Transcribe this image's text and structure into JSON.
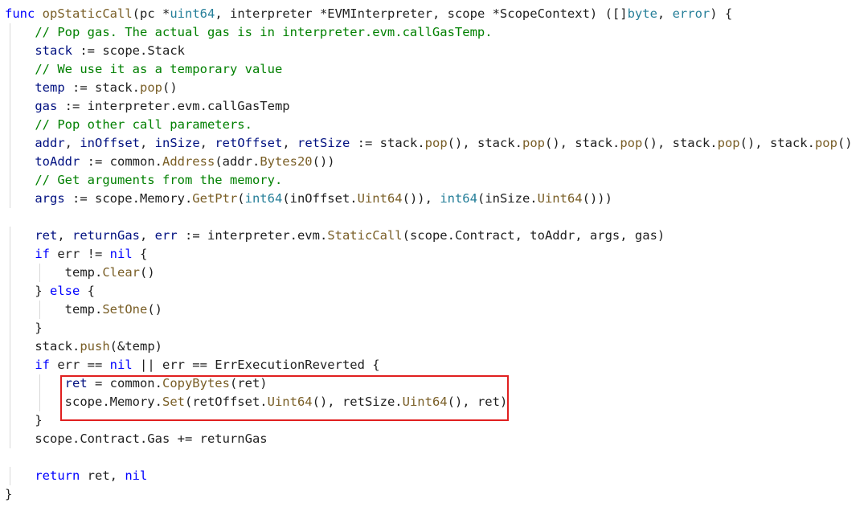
{
  "editor": {
    "theme": "light",
    "highlight_color": "#e02020"
  },
  "code_lines": [
    [
      [
        "kw",
        "func "
      ],
      [
        "fn",
        "opStaticCall"
      ],
      [
        "pl",
        "(pc "
      ],
      [
        "pl",
        "*"
      ],
      [
        "ty",
        "uint64"
      ],
      [
        "pl",
        ", interpreter *EVMInterpreter, scope *ScopeContext) ([]"
      ],
      [
        "ty",
        "byte"
      ],
      [
        "pl",
        ", "
      ],
      [
        "ty",
        "error"
      ],
      [
        "pl",
        ") {"
      ]
    ],
    [
      [
        "cm",
        "// Pop gas. The actual gas is in interpreter.evm.callGasTemp."
      ]
    ],
    [
      [
        "var",
        "stack"
      ],
      [
        "pl",
        " := scope.Stack"
      ]
    ],
    [
      [
        "cm",
        "// We use it as a temporary value"
      ]
    ],
    [
      [
        "var",
        "temp"
      ],
      [
        "pl",
        " := stack."
      ],
      [
        "fn",
        "pop"
      ],
      [
        "pl",
        "()"
      ]
    ],
    [
      [
        "var",
        "gas"
      ],
      [
        "pl",
        " := interpreter.evm.callGasTemp"
      ]
    ],
    [
      [
        "cm",
        "// Pop other call parameters."
      ]
    ],
    [
      [
        "var",
        "addr"
      ],
      [
        "pl",
        ", "
      ],
      [
        "var",
        "inOffset"
      ],
      [
        "pl",
        ", "
      ],
      [
        "var",
        "inSize"
      ],
      [
        "pl",
        ", "
      ],
      [
        "var",
        "retOffset"
      ],
      [
        "pl",
        ", "
      ],
      [
        "var",
        "retSize"
      ],
      [
        "pl",
        " := stack."
      ],
      [
        "fn",
        "pop"
      ],
      [
        "pl",
        "(), stack."
      ],
      [
        "fn",
        "pop"
      ],
      [
        "pl",
        "(), stack."
      ],
      [
        "fn",
        "pop"
      ],
      [
        "pl",
        "(), stack."
      ],
      [
        "fn",
        "pop"
      ],
      [
        "pl",
        "(), stack."
      ],
      [
        "fn",
        "pop"
      ],
      [
        "pl",
        "()"
      ]
    ],
    [
      [
        "var",
        "toAddr"
      ],
      [
        "pl",
        " := common."
      ],
      [
        "fn",
        "Address"
      ],
      [
        "pl",
        "(addr."
      ],
      [
        "fn",
        "Bytes20"
      ],
      [
        "pl",
        "())"
      ]
    ],
    [
      [
        "cm",
        "// Get arguments from the memory."
      ]
    ],
    [
      [
        "var",
        "args"
      ],
      [
        "pl",
        " := scope.Memory."
      ],
      [
        "fn",
        "GetPtr"
      ],
      [
        "pl",
        "("
      ],
      [
        "ty",
        "int64"
      ],
      [
        "pl",
        "(inOffset."
      ],
      [
        "fn",
        "Uint64"
      ],
      [
        "pl",
        "()), "
      ],
      [
        "ty",
        "int64"
      ],
      [
        "pl",
        "(inSize."
      ],
      [
        "fn",
        "Uint64"
      ],
      [
        "pl",
        "()))"
      ]
    ],
    [],
    [
      [
        "var",
        "ret"
      ],
      [
        "pl",
        ", "
      ],
      [
        "var",
        "returnGas"
      ],
      [
        "pl",
        ", "
      ],
      [
        "var",
        "err"
      ],
      [
        "pl",
        " := interpreter.evm."
      ],
      [
        "fn",
        "StaticCall"
      ],
      [
        "pl",
        "(scope.Contract, toAddr, args, gas)"
      ]
    ],
    [
      [
        "kw",
        "if "
      ],
      [
        "pl",
        "err != "
      ],
      [
        "kw",
        "nil"
      ],
      [
        "pl",
        " {"
      ]
    ],
    [
      [
        "pl",
        "temp."
      ],
      [
        "fn",
        "Clear"
      ],
      [
        "pl",
        "()"
      ]
    ],
    [
      [
        "pl",
        "} "
      ],
      [
        "kw",
        "else"
      ],
      [
        "pl",
        " {"
      ]
    ],
    [
      [
        "pl",
        "temp."
      ],
      [
        "fn",
        "SetOne"
      ],
      [
        "pl",
        "()"
      ]
    ],
    [
      [
        "pl",
        "}"
      ]
    ],
    [
      [
        "pl",
        "stack."
      ],
      [
        "fn",
        "push"
      ],
      [
        "pl",
        "(&temp)"
      ]
    ],
    [
      [
        "kw",
        "if "
      ],
      [
        "pl",
        "err == "
      ],
      [
        "kw",
        "nil"
      ],
      [
        "pl",
        " || err == ErrExecutionReverted {"
      ]
    ],
    [
      [
        "var",
        "ret"
      ],
      [
        "pl",
        " = common."
      ],
      [
        "fn",
        "CopyBytes"
      ],
      [
        "pl",
        "(ret)"
      ]
    ],
    [
      [
        "pl",
        "scope.Memory."
      ],
      [
        "fn",
        "Set"
      ],
      [
        "pl",
        "(retOffset."
      ],
      [
        "fn",
        "Uint64"
      ],
      [
        "pl",
        "(), retSize."
      ],
      [
        "fn",
        "Uint64"
      ],
      [
        "pl",
        "(), ret)"
      ]
    ],
    [
      [
        "pl",
        "}"
      ]
    ],
    [
      [
        "pl",
        "scope.Contract.Gas += returnGas"
      ]
    ],
    [],
    [
      [
        "kw",
        "return "
      ],
      [
        "pl",
        "ret, "
      ],
      [
        "kw",
        "nil"
      ]
    ],
    [
      [
        "pl",
        "}"
      ]
    ]
  ]
}
